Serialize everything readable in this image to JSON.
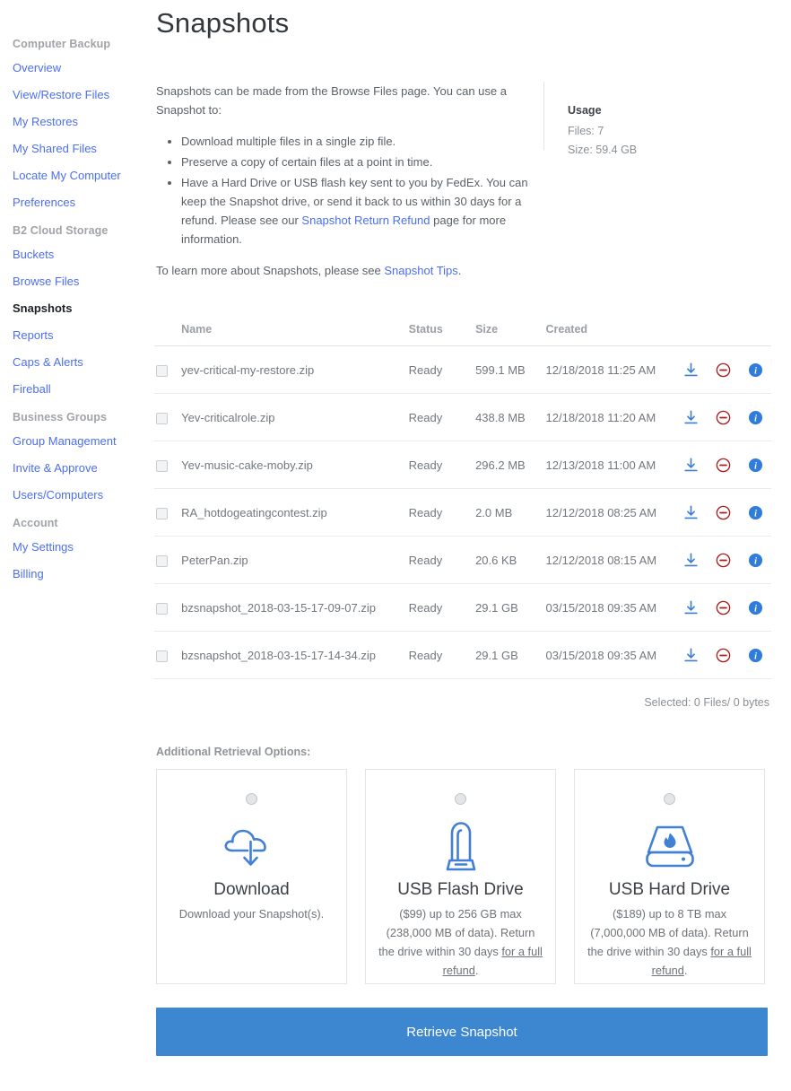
{
  "page": {
    "title": "Snapshots"
  },
  "sidebar": {
    "groups": [
      {
        "heading": "Computer Backup",
        "items": [
          {
            "label": "Overview",
            "active": false
          },
          {
            "label": "View/Restore Files",
            "active": false
          },
          {
            "label": "My Restores",
            "active": false
          },
          {
            "label": "My Shared Files",
            "active": false
          },
          {
            "label": "Locate My Computer",
            "active": false
          },
          {
            "label": "Preferences",
            "active": false
          }
        ]
      },
      {
        "heading": "B2 Cloud Storage",
        "items": [
          {
            "label": "Buckets",
            "active": false
          },
          {
            "label": "Browse Files",
            "active": false
          },
          {
            "label": "Snapshots",
            "active": true
          },
          {
            "label": "Reports",
            "active": false
          },
          {
            "label": "Caps & Alerts",
            "active": false
          },
          {
            "label": "Fireball",
            "active": false
          }
        ]
      },
      {
        "heading": "Business Groups",
        "items": [
          {
            "label": "Group Management",
            "active": false
          },
          {
            "label": "Invite & Approve",
            "active": false
          },
          {
            "label": "Users/Computers",
            "active": false
          }
        ]
      },
      {
        "heading": "Account",
        "items": [
          {
            "label": "My Settings",
            "active": false
          },
          {
            "label": "Billing",
            "active": false
          }
        ]
      }
    ]
  },
  "intro": {
    "lead": "Snapshots can be made from the Browse Files page. You can use a Snapshot to:",
    "bullets": [
      "Download multiple files in a single zip file.",
      "Preserve a copy of certain files at a point in time."
    ],
    "bullet3_part1": "Have a Hard Drive or USB flash key sent to you by FedEx. You can keep the Snapshot drive, or send it back to us within 30 days for a refund. Please see our ",
    "bullet3_link": "Snapshot Return Refund",
    "bullet3_part2": " page for more information.",
    "footer_part1": "To learn more about Snapshots, please see ",
    "footer_link": "Snapshot Tips",
    "footer_part2": "."
  },
  "usage": {
    "title": "Usage",
    "files": "Files: 7",
    "size": "Size: 59.4 GB"
  },
  "table": {
    "headers": [
      "Name",
      "Status",
      "Size",
      "Created"
    ],
    "rows": [
      {
        "name": "yev-critical-my-restore.zip",
        "status": "Ready",
        "size": "599.1 MB",
        "created": "12/18/2018 11:25 AM"
      },
      {
        "name": "Yev-criticalrole.zip",
        "status": "Ready",
        "size": "438.8 MB",
        "created": "12/18/2018 11:20 AM"
      },
      {
        "name": "Yev-music-cake-moby.zip",
        "status": "Ready",
        "size": "296.2 MB",
        "created": "12/13/2018 11:00 AM"
      },
      {
        "name": "RA_hotdogeatingcontest.zip",
        "status": "Ready",
        "size": "2.0 MB",
        "created": "12/12/2018 08:25 AM"
      },
      {
        "name": "PeterPan.zip",
        "status": "Ready",
        "size": "20.6 KB",
        "created": "12/12/2018 08:15 AM"
      },
      {
        "name": "bzsnapshot_2018-03-15-17-09-07.zip",
        "status": "Ready",
        "size": "29.1 GB",
        "created": "03/15/2018 09:35 AM"
      },
      {
        "name": "bzsnapshot_2018-03-15-17-14-34.zip",
        "status": "Ready",
        "size": "29.1 GB",
        "created": "03/15/2018 09:35 AM"
      }
    ],
    "selected_summary": "Selected: 0 Files/ 0 bytes"
  },
  "retrieval": {
    "label": "Additional Retrieval Options:",
    "cards": [
      {
        "icon": "cloud-download-icon",
        "title": "Download",
        "desc_part1": "Download your Snapshot(s).",
        "desc_link": "",
        "desc_part2": ""
      },
      {
        "icon": "usb-flash-drive-icon",
        "title": "USB Flash Drive",
        "desc_part1": "($99) up to 256 GB max (238,000 MB of data). Return the drive within 30 days ",
        "desc_link": "for a full refund",
        "desc_part2": "."
      },
      {
        "icon": "usb-hard-drive-icon",
        "title": "USB Hard Drive",
        "desc_part1": "($189) up to 8 TB max (7,000,000 MB of data). Return the drive within 30 days ",
        "desc_link": "for a full refund",
        "desc_part2": "."
      }
    ],
    "submit_label": "Retrieve Snapshot"
  },
  "colors": {
    "link": "#4c6ef0",
    "primary_button": "#3d87d0",
    "icon_blue": "#3d7fd0",
    "icon_red": "#a81c1c",
    "info_blue": "#2f7cdb"
  }
}
